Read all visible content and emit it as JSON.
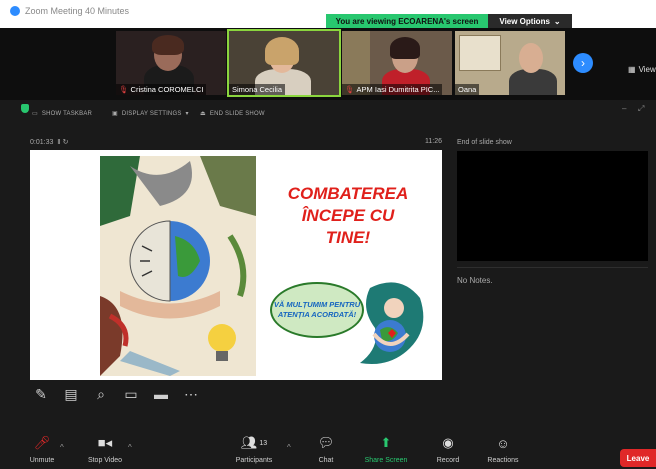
{
  "window": {
    "title": "Zoom Meeting 40 Minutes"
  },
  "banner": {
    "viewing_text": "You are viewing ECOARENA's screen",
    "view_options_label": "View Options"
  },
  "participants_strip": [
    {
      "name": "Cristina COROMELCI",
      "muted": true
    },
    {
      "name": "Simona Cecilia",
      "muted": false,
      "active": true
    },
    {
      "name": "APM Iasi Dumitrita PIC...",
      "muted": true
    },
    {
      "name": "Oana",
      "muted": false
    }
  ],
  "view_label": "View",
  "share_toolbar": {
    "show_taskbar": "SHOW TASKBAR",
    "display_settings": "DISPLAY SETTINGS",
    "end_slide_show": "END SLIDE SHOW"
  },
  "presenter": {
    "elapsed": "0:01:33",
    "clock": "11:26"
  },
  "slide": {
    "title_lines": [
      "COMBATEREA",
      "ÎNCEPE CU",
      "TINE!"
    ],
    "bubble_text": "VĂ MULȚUMIM PENTRU ATENȚIA ACORDATĂ!"
  },
  "side_panel": {
    "next_label": "End of slide show",
    "notes": "No Notes."
  },
  "bottom_bar": {
    "unmute": "Unmute",
    "stop_video": "Stop Video",
    "participants": "Participants",
    "participants_count": "13",
    "chat": "Chat",
    "share_screen": "Share Screen",
    "record": "Record",
    "reactions": "Reactions",
    "leave": "Leave"
  },
  "colors": {
    "accent_green": "#28c76f",
    "zoom_blue": "#2d8cff",
    "leave_red": "#e02828",
    "slide_title_red": "#e0201b"
  }
}
